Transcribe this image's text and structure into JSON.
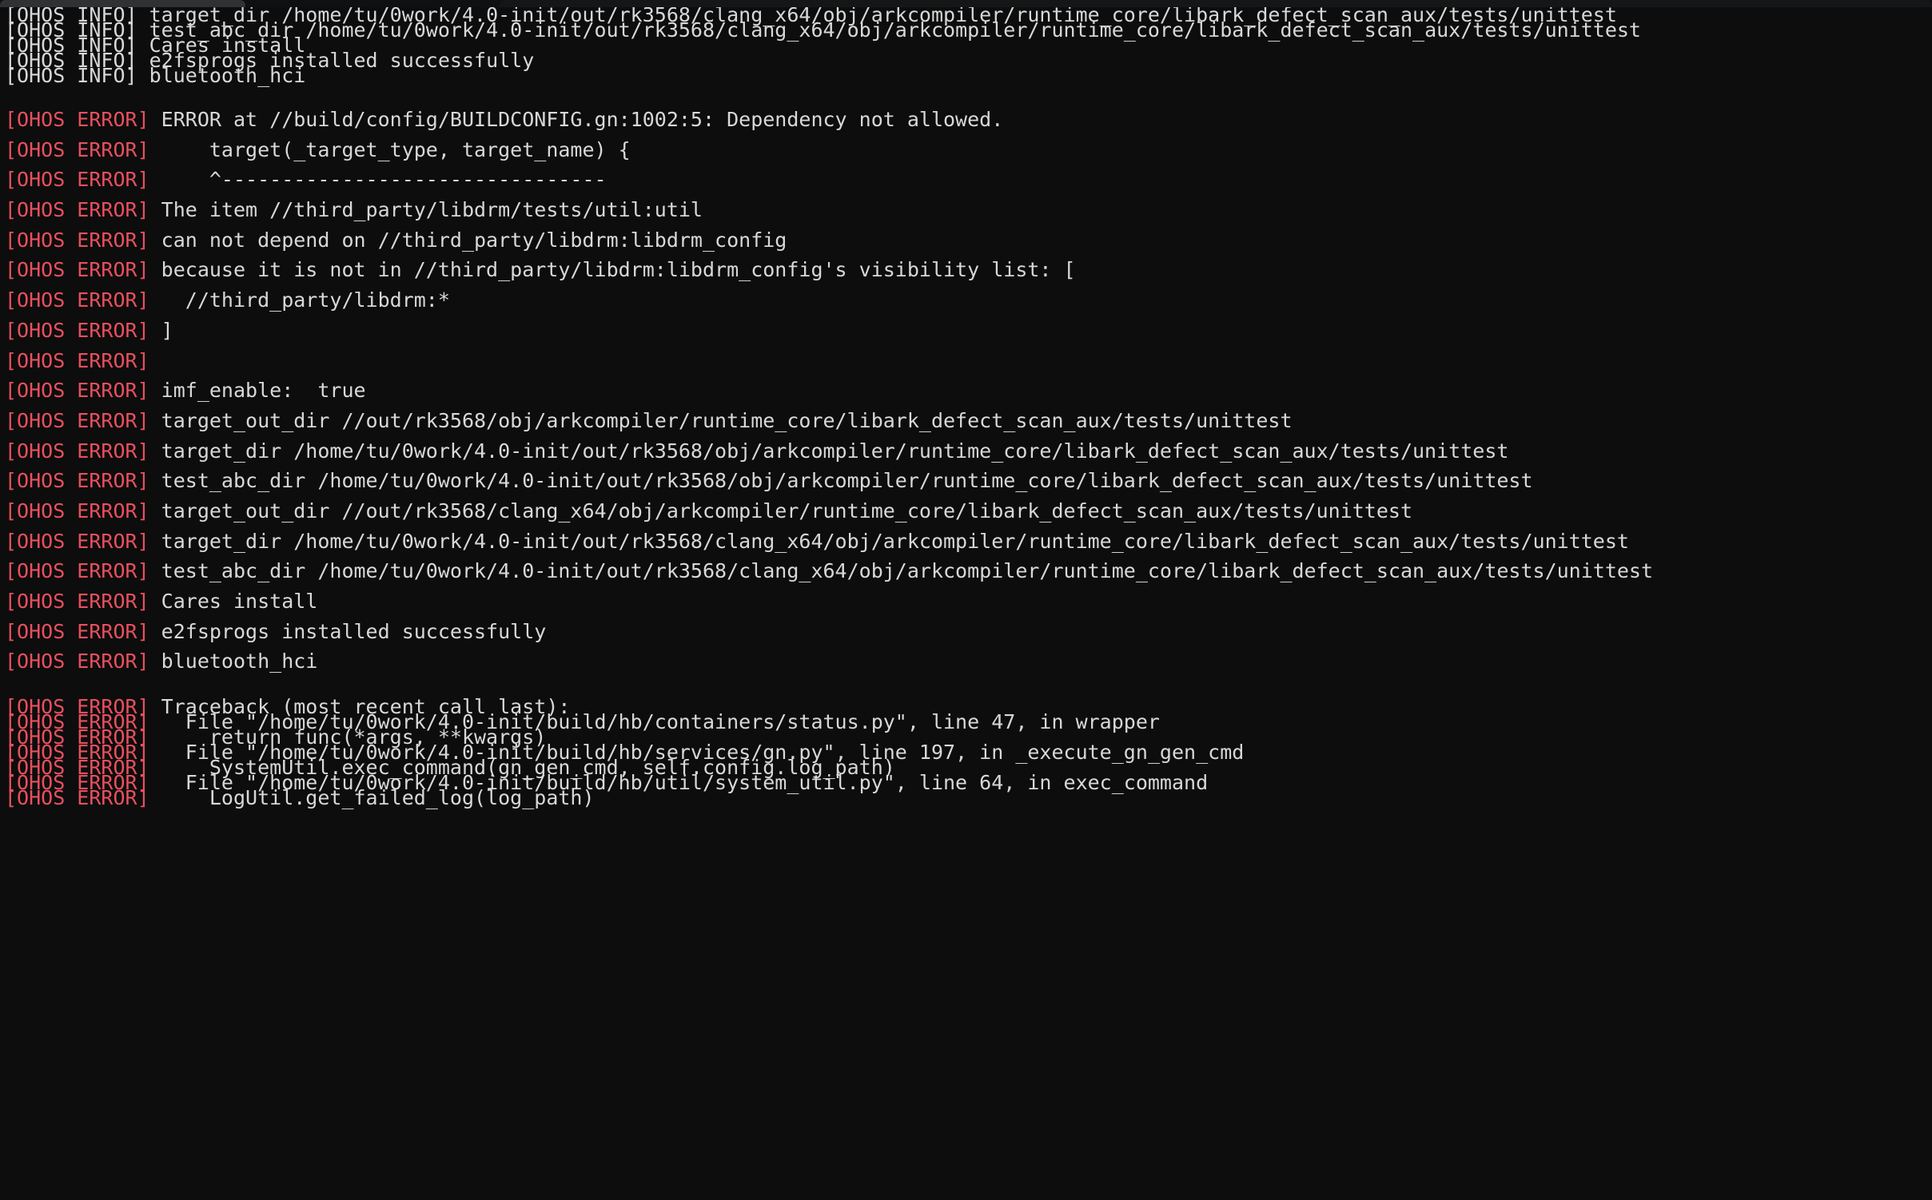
{
  "window": {
    "type": "terminal-emulator",
    "background_color": "#0d0d0d",
    "foreground_color": "#d8d8d8",
    "error_color": "#e8505f",
    "tabstrip_color": "#2f3133"
  },
  "tags": {
    "info": "[OHOS INFO]",
    "error": "[OHOS ERROR]"
  },
  "info_block": [
    {
      "tag": "info",
      "text": " target_dir /home/tu/0work/4.0-init/out/rk3568/clang_x64/obj/arkcompiler/runtime_core/libark_defect_scan_aux/tests/unittest"
    },
    {
      "tag": "info",
      "text": " test_abc_dir /home/tu/0work/4.0-init/out/rk3568/clang_x64/obj/arkcompiler/runtime_core/libark_defect_scan_aux/tests/unittest"
    },
    {
      "tag": "info",
      "text": " Cares install"
    },
    {
      "tag": "info",
      "text": " e2fsprogs installed successfully"
    },
    {
      "tag": "info",
      "text": " bluetooth_hci"
    }
  ],
  "error_block": [
    {
      "tag": "error",
      "text": " ERROR at //build/config/BUILDCONFIG.gn:1002:5: Dependency not allowed."
    },
    {
      "tag": "error",
      "text": "     target(_target_type, target_name) {"
    },
    {
      "tag": "error",
      "text": "     ^--------------------------------"
    },
    {
      "tag": "error",
      "text": " The item //third_party/libdrm/tests/util:util"
    },
    {
      "tag": "error",
      "text": " can not depend on //third_party/libdrm:libdrm_config"
    },
    {
      "tag": "error",
      "text": " because it is not in //third_party/libdrm:libdrm_config's visibility list: ["
    },
    {
      "tag": "error",
      "text": "   //third_party/libdrm:*"
    },
    {
      "tag": "error",
      "text": " ]"
    },
    {
      "tag": "error",
      "text": ""
    },
    {
      "tag": "error",
      "text": " imf_enable:  true"
    },
    {
      "tag": "error",
      "text": " target_out_dir //out/rk3568/obj/arkcompiler/runtime_core/libark_defect_scan_aux/tests/unittest"
    },
    {
      "tag": "error",
      "text": " target_dir /home/tu/0work/4.0-init/out/rk3568/obj/arkcompiler/runtime_core/libark_defect_scan_aux/tests/unittest"
    },
    {
      "tag": "error",
      "text": " test_abc_dir /home/tu/0work/4.0-init/out/rk3568/obj/arkcompiler/runtime_core/libark_defect_scan_aux/tests/unittest"
    },
    {
      "tag": "error",
      "text": " target_out_dir //out/rk3568/clang_x64/obj/arkcompiler/runtime_core/libark_defect_scan_aux/tests/unittest"
    },
    {
      "tag": "error",
      "text": " target_dir /home/tu/0work/4.0-init/out/rk3568/clang_x64/obj/arkcompiler/runtime_core/libark_defect_scan_aux/tests/unittest"
    },
    {
      "tag": "error",
      "text": " test_abc_dir /home/tu/0work/4.0-init/out/rk3568/clang_x64/obj/arkcompiler/runtime_core/libark_defect_scan_aux/tests/unittest"
    },
    {
      "tag": "error",
      "text": " Cares install"
    },
    {
      "tag": "error",
      "text": " e2fsprogs installed successfully"
    },
    {
      "tag": "error",
      "text": " bluetooth_hci"
    }
  ],
  "traceback_block": [
    {
      "tag": "error",
      "text": " Traceback (most recent call last):"
    },
    {
      "tag": "error",
      "text": "   File \"/home/tu/0work/4.0-init/build/hb/containers/status.py\", line 47, in wrapper"
    },
    {
      "tag": "error",
      "text": "     return func(*args, **kwargs)"
    },
    {
      "tag": "error",
      "text": "   File \"/home/tu/0work/4.0-init/build/hb/services/gn.py\", line 197, in _execute_gn_gen_cmd"
    },
    {
      "tag": "error",
      "text": "     SystemUtil.exec_command(gn_gen_cmd, self.config.log_path)"
    },
    {
      "tag": "error",
      "text": "   File \"/home/tu/0work/4.0-init/build/hb/util/system_util.py\", line 64, in exec_command"
    },
    {
      "tag": "error",
      "text": "     LogUtil.get_failed_log(log_path)"
    }
  ]
}
